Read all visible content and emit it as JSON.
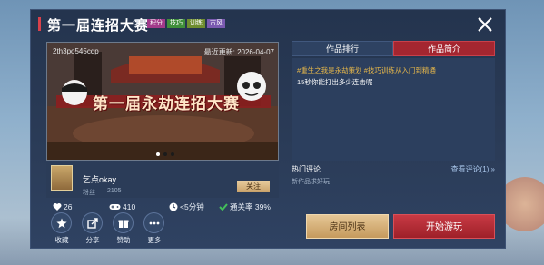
{
  "window": {
    "title": "第一届连招大赛",
    "help_icon": "help-icon",
    "close_icon": "close-icon"
  },
  "tags": [
    {
      "label": "积分",
      "color": "#a23a8a"
    },
    {
      "label": "技巧",
      "color": "#3f8f3a"
    },
    {
      "label": "训练",
      "color": "#6f8d2f"
    },
    {
      "label": "古风",
      "color": "#7a5ab0"
    }
  ],
  "banner": {
    "id_text": "2th3po545cdp",
    "updated": "最近更新: 2026-04-07",
    "title": "第一届永劫连招大赛",
    "page_count": 3,
    "active_page": 1
  },
  "author": {
    "name": "乞点okay",
    "fans_label": "粉丝",
    "fans_count": "2105",
    "follow_label": "关注"
  },
  "stats": {
    "likes": "26",
    "plays": "410",
    "duration": "<5分钟",
    "clear_rate": "通关率 39%"
  },
  "actions": [
    {
      "label": "收藏",
      "icon": "star-icon"
    },
    {
      "label": "分享",
      "icon": "share-icon"
    },
    {
      "label": "赞助",
      "icon": "sponsor-icon"
    },
    {
      "label": "更多",
      "icon": "more-icon"
    }
  ],
  "tabs": [
    {
      "label": "作品排行",
      "active": false
    },
    {
      "label": "作品简介",
      "active": true
    }
  ],
  "intro": {
    "hashtags": "#重生之我是永劫策划   #技巧训练从入门到精通",
    "description": "15秒你能打出多少连击呢"
  },
  "comments": {
    "heading": "热门评论",
    "view_all": "查看评论(1)",
    "empty_text": "新作品求好玩"
  },
  "buttons": {
    "rooms": "房间列表",
    "play": "开始游玩"
  },
  "colors": {
    "accent_red": "#a42630",
    "gold": "#c59a5d",
    "panel": "#2b3c58"
  }
}
